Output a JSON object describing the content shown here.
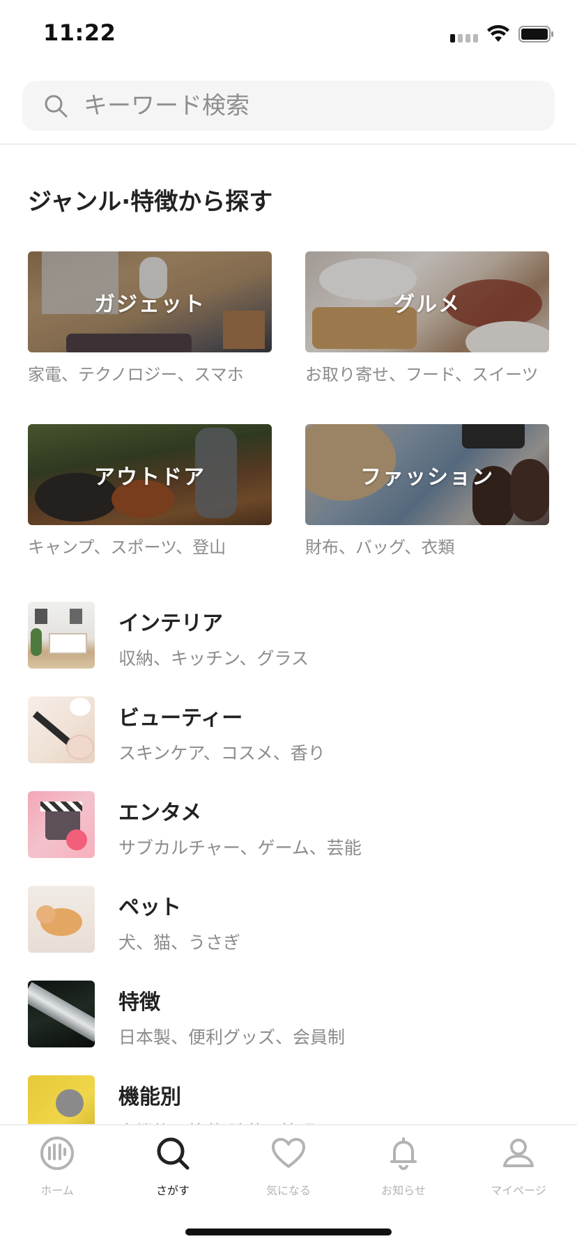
{
  "status": {
    "time": "11:22"
  },
  "search": {
    "placeholder": "キーワード検索"
  },
  "section": {
    "title": "ジャンル·特徴から探す"
  },
  "genres": [
    {
      "label": "ガジェット",
      "sub": "家電、テクノロジー、スマホ"
    },
    {
      "label": "グルメ",
      "sub": "お取り寄せ、フード、スイーツ"
    },
    {
      "label": "アウトドア",
      "sub": "キャンプ、スポーツ、登山"
    },
    {
      "label": "ファッション",
      "sub": "財布、バッグ、衣類"
    }
  ],
  "categories": [
    {
      "title": "インテリア",
      "sub": "収納、キッチン、グラス"
    },
    {
      "title": "ビューティー",
      "sub": "スキンケア、コスメ、香り"
    },
    {
      "title": "エンタメ",
      "sub": "サブカルチャー、ゲーム、芸能"
    },
    {
      "title": "ペット",
      "sub": "犬、猫、うさぎ"
    },
    {
      "title": "特徴",
      "sub": "日本製、便利グッズ、会員制"
    },
    {
      "title": "機能別",
      "sub": "多機能、抗菌·除菌、快眠"
    }
  ],
  "tabs": [
    {
      "label": "ホーム",
      "icon": "home-logo-icon",
      "active": false
    },
    {
      "label": "さがす",
      "icon": "search-icon",
      "active": true
    },
    {
      "label": "気になる",
      "icon": "heart-icon",
      "active": false
    },
    {
      "label": "お知らせ",
      "icon": "bell-icon",
      "active": false
    },
    {
      "label": "マイページ",
      "icon": "person-icon",
      "active": false
    }
  ],
  "colors": {
    "text": "#222222",
    "subtext": "#8b8b8b",
    "search_bg": "#f5f5f5",
    "tab_inactive": "#b3b3b3"
  }
}
